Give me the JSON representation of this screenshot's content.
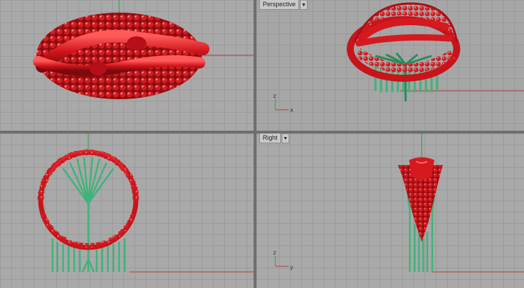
{
  "viewports": {
    "top": {
      "label": ""
    },
    "perspective": {
      "label": "Perspective",
      "menu_icon": "chevron-down-icon"
    },
    "front": {
      "label": ""
    },
    "right": {
      "label": "Right",
      "menu_icon": "chevron-down-icon"
    }
  },
  "axis_widget": {
    "perspective": {
      "a": "z",
      "b": "x"
    },
    "right": {
      "a": "z",
      "b": "y"
    }
  },
  "colors": {
    "ring_red": "#c8141a",
    "prong_green": "#3fb37a",
    "axis_red": "#b43c3c",
    "axis_green": "#2f9a4a",
    "grid_bg": "#a9a9a9",
    "divider": "#6e6e6e"
  }
}
